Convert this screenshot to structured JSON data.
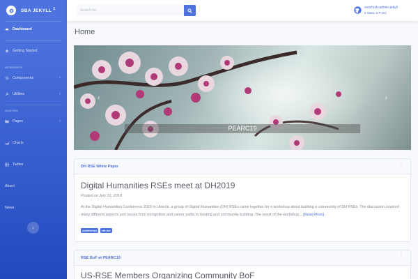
{
  "brand": {
    "name": "SBA JEKYLL",
    "version": "1"
  },
  "sidebar": {
    "dashboard": "Dashboard",
    "getting_started": "Getting Started",
    "heading_interface": "INTERFACE",
    "components": "Components",
    "utilities": "Utilities",
    "heading_addons": "ADDONS",
    "pages": "Pages",
    "charts": "Charts",
    "tables": "Tables",
    "about": "About",
    "news": "News"
  },
  "search": {
    "placeholder": "Search for..."
  },
  "repo": {
    "name": "vsoch/sb-admin-jekyll",
    "stats": "6 Stars, 2 Forks"
  },
  "page": {
    "title": "Home"
  },
  "carousel": {
    "caption": "PEARC19"
  },
  "posts": [
    {
      "header": "DH RSE White Paper",
      "title": "Digital Humanities RSEs meet at DH2019",
      "date": "Posted on July 31, 2019",
      "body": "At the Digital Humanities Conference 2019 in Utrecht, a group of Digital Humanities (DH) RSEs came together for a workshop about building a community of DH RSEs. The discussion covered many different aspects and issues from recognition and career paths to funding and community building. The result of the workshop...",
      "read_more": "[Read More]",
      "tags": [
        "conference",
        "dh-rse"
      ]
    },
    {
      "header": "RSE BoF at PEARC19",
      "title": "US-RSE Members Organizing Community BoF"
    }
  ],
  "colors": {
    "primary": "#4e73df",
    "sidebar_dark": "#224abe",
    "text": "#858796",
    "heading": "#5a5c69"
  }
}
